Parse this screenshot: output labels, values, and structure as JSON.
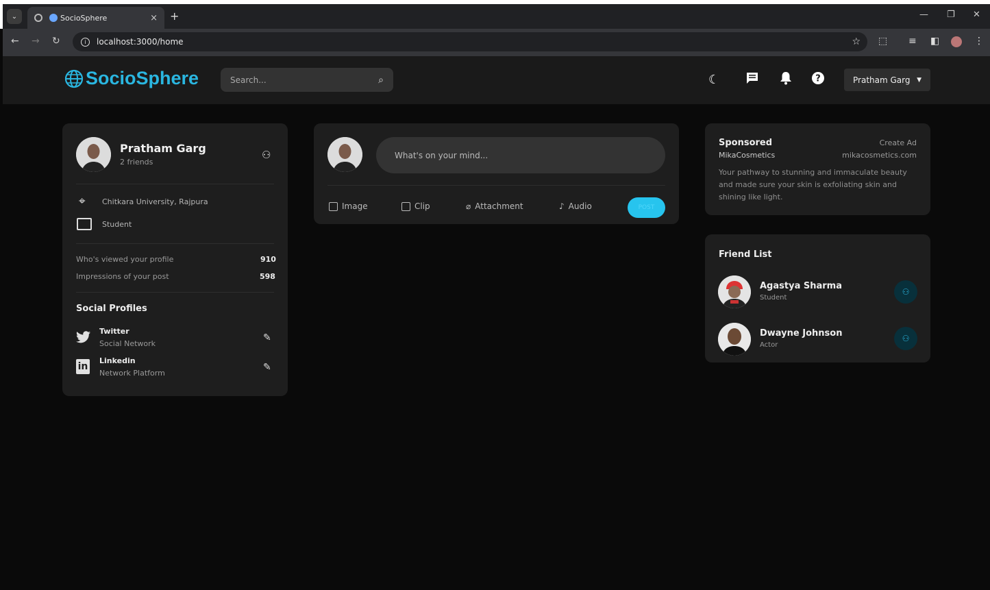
{
  "browser": {
    "tab_title": "SocioSphere",
    "tab_fav_label": "SocioSphere",
    "close": "×",
    "new_tab": "+",
    "url": "localhost:3000/home"
  },
  "app": {
    "logo": "SocioSphere",
    "search_placeholder": "Search...",
    "user_button": "Pratham Garg"
  },
  "profile": {
    "name": "Pratham Garg",
    "friends": "2 friends",
    "location": "Chitkara University, Rajpura",
    "occupation": "Student",
    "viewed_label": "Who's viewed your profile",
    "viewed_value": "910",
    "impressions_label": "Impressions of your post",
    "impressions_value": "598",
    "social_title": "Social Profiles",
    "socials": [
      {
        "name": "Twitter",
        "type": "Social Network"
      },
      {
        "name": "Linkedin",
        "type": "Network Platform"
      }
    ]
  },
  "composer": {
    "placeholder": "What's on your mind...",
    "actions": [
      "Image",
      "Clip",
      "Attachment",
      "Audio"
    ],
    "post": "POST"
  },
  "sponsored": {
    "title": "Sponsored",
    "create": "Create Ad",
    "brand": "MikaCosmetics",
    "site": "mikacosmetics.com",
    "description": "Your pathway to stunning and immaculate beauty and made sure your skin is exfoliating skin and shining like light."
  },
  "friend_list": {
    "title": "Friend List",
    "friends": [
      {
        "name": "Agastya Sharma",
        "role": "Student"
      },
      {
        "name": "Dwayne Johnson",
        "role": "Actor"
      }
    ]
  },
  "colors": {
    "accent": "#2ab6e0",
    "card": "#1e1e1e",
    "background": "#0a0a0a"
  }
}
